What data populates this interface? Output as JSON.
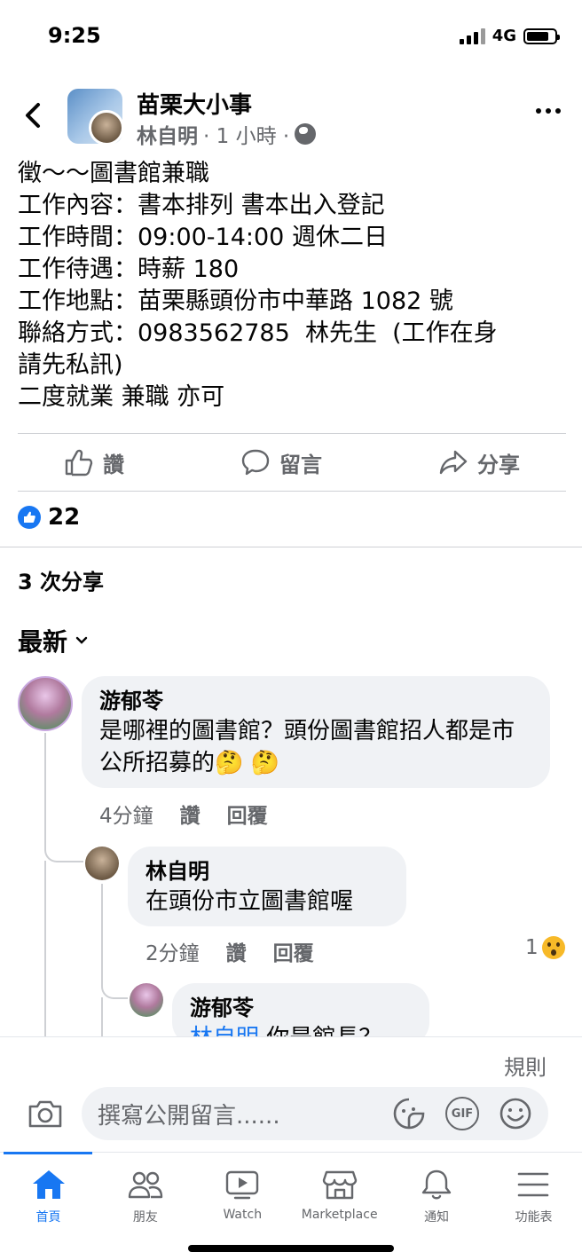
{
  "status": {
    "time": "9:25",
    "network": "4G"
  },
  "post": {
    "group_name": "苗栗大小事",
    "author": "林自明",
    "time": "· 1 小時 ·",
    "body_lines": [
      "徵～～圖書館兼職",
      "工作內容：書本排列 書本出入登記",
      "工作時間：09:00-14:00 週休二日",
      "工作待遇：時薪 180",
      "工作地點：苗栗縣頭份市中華路 1082 號",
      "聯絡方式：0983562785  林先生  (工作在身",
      "請先私訊)",
      "二度就業 兼職 亦可"
    ],
    "actions": {
      "like": "讚",
      "comment": "留言",
      "share": "分享"
    },
    "reaction_count": "22",
    "shares": "3 次分享"
  },
  "comments": {
    "sort_label": "最新",
    "items": [
      {
        "name": "游郁苓",
        "text": "是哪裡的圖書館？頭份圖書館招人都是市公所招募的🤔 🤔",
        "time": "4分鐘",
        "like": "讚",
        "reply": "回覆"
      },
      {
        "name": "林自明",
        "text": "在頭份市立圖書館喔",
        "time": "2分鐘",
        "like": "讚",
        "reply": "回覆",
        "reaction_count": "1"
      },
      {
        "name": "游郁苓",
        "mention": "林自明",
        "text": " 你是館長？"
      }
    ]
  },
  "composer": {
    "rules": "規則",
    "placeholder": "撰寫公開留言......"
  },
  "tabs": [
    {
      "label": "首頁",
      "icon": "home-icon",
      "active": true
    },
    {
      "label": "朋友",
      "icon": "friends-icon"
    },
    {
      "label": "Watch",
      "icon": "watch-icon"
    },
    {
      "label": "Marketplace",
      "icon": "marketplace-icon"
    },
    {
      "label": "通知",
      "icon": "bell-icon"
    },
    {
      "label": "功能表",
      "icon": "menu-icon"
    }
  ],
  "colors": {
    "accent": "#1877f2",
    "secondary_text": "#65676b",
    "bubble": "#f0f2f5"
  }
}
